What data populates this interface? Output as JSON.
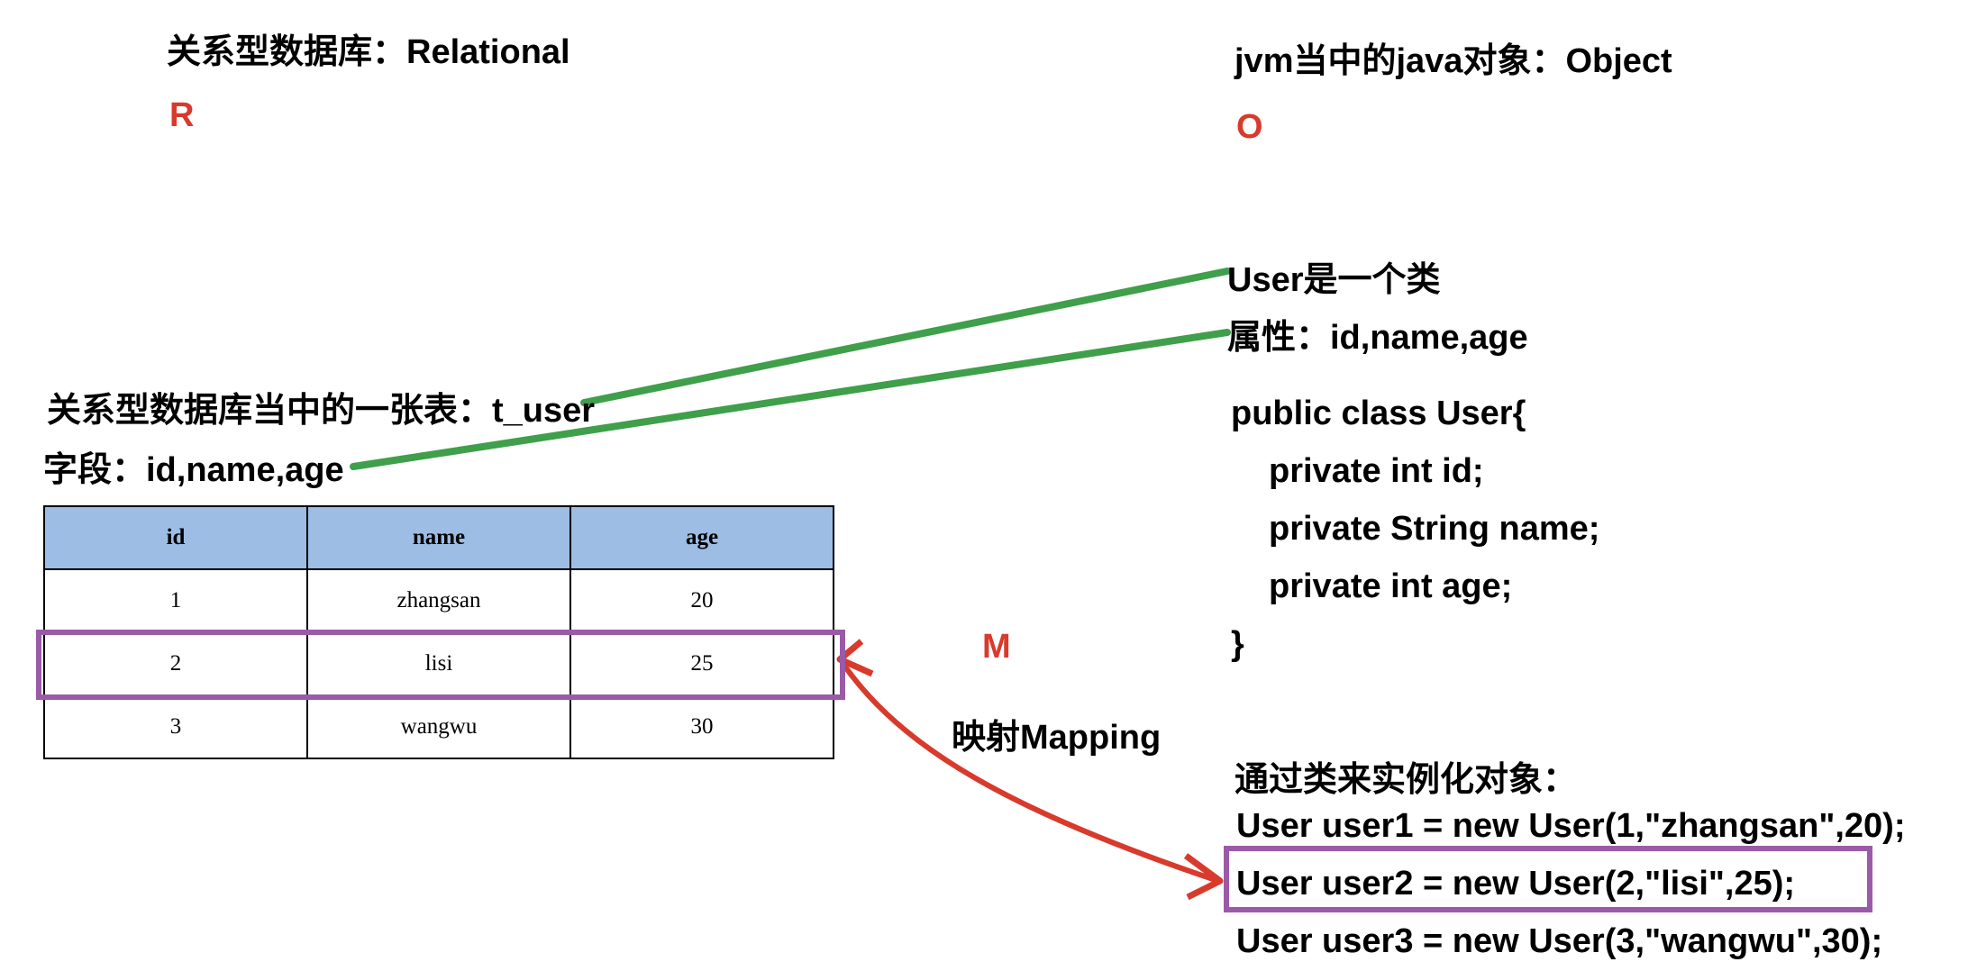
{
  "relational": {
    "title": "关系型数据库：Relational",
    "letter": "R",
    "table_desc": "关系型数据库当中的一张表：t_user",
    "fields_desc": "字段：id,name,age"
  },
  "object": {
    "title": "jvm当中的java对象：Object",
    "letter": "O",
    "class_desc": "User是一个类",
    "attrs_desc": "属性：id,name,age",
    "code": [
      "public class User{",
      "    private int id;",
      "    private String name;",
      "    private int age;",
      "}"
    ],
    "instantiate_title": "通过类来实例化对象：",
    "instances": [
      "User user1 = new User(1,\"zhangsan\",20);",
      "User user2 = new User(2,\"lisi\",25);",
      "User user3 = new User(3,\"wangwu\",30);"
    ]
  },
  "mapping": {
    "letter": "M",
    "label": "映射Mapping"
  },
  "table": {
    "headers": [
      "id",
      "name",
      "age"
    ],
    "rows": [
      [
        "1",
        "zhangsan",
        "20"
      ],
      [
        "2",
        "lisi",
        "25"
      ],
      [
        "3",
        "wangwu",
        "30"
      ]
    ]
  },
  "colors": {
    "green_line": "#3f9f4a",
    "red_arrow": "#d83a2c",
    "highlight_box": "#9b5aa8",
    "header_fill": "#9dbde4"
  }
}
